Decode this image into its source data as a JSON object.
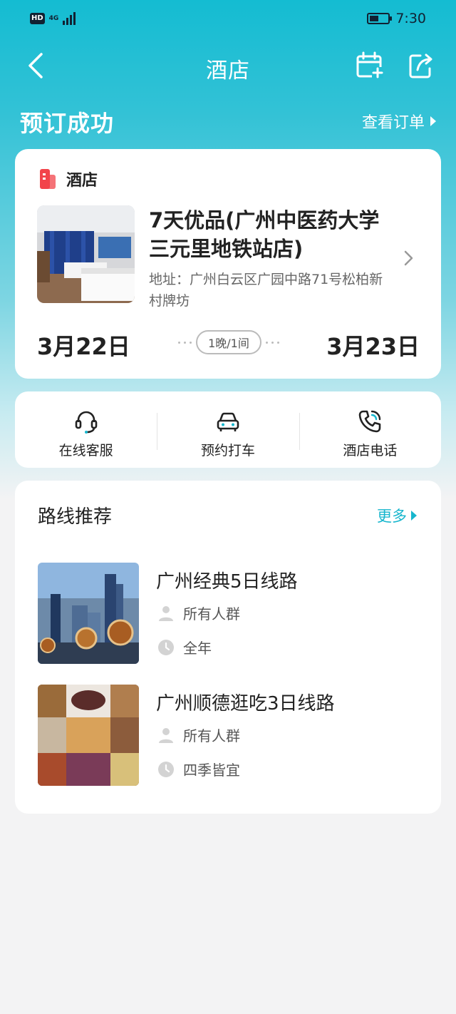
{
  "status_bar": {
    "hd": "HD",
    "network": "4G",
    "time": "7:30"
  },
  "nav": {
    "title": "酒店",
    "icons": [
      "back-icon",
      "calendar-add-icon",
      "share-icon"
    ]
  },
  "header": {
    "success_text": "预订成功",
    "view_order": "查看订单"
  },
  "hotel_card": {
    "tag": "酒店",
    "name": "7天优品(广州中医药大学三元里地铁站店)",
    "address": "地址：广州白云区广园中路71号松柏新村牌坊",
    "check_in": "3月22日",
    "check_out": "3月23日",
    "nights": "1晚/1间"
  },
  "actions": [
    {
      "label": "在线客服",
      "icon": "headset-icon"
    },
    {
      "label": "预约打车",
      "icon": "car-icon"
    },
    {
      "label": "酒店电话",
      "icon": "phone-icon"
    }
  ],
  "routes": {
    "title": "路线推荐",
    "more": "更多",
    "items": [
      {
        "name": "广州经典5日线路",
        "audience": "所有人群",
        "season": "全年"
      },
      {
        "name": "广州顺德逛吃3日线路",
        "audience": "所有人群",
        "season": "四季皆宜"
      }
    ]
  },
  "colors": {
    "accent": "#17b6cd",
    "header_gradient_top": "#14bcd2",
    "hotel_tag_red": "#f2444b"
  }
}
